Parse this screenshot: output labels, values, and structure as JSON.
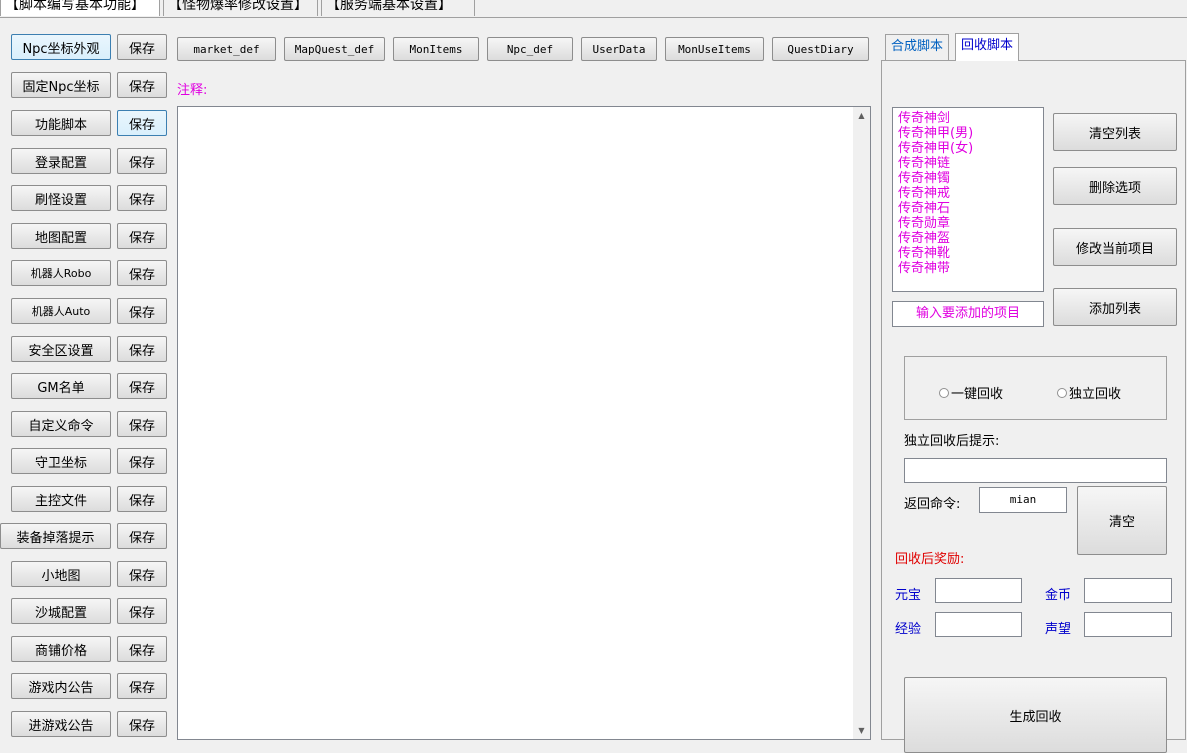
{
  "top_tabs": [
    {
      "label": "【脚本编写基本功能】",
      "active": true
    },
    {
      "label": "【怪物爆率修改设置】",
      "active": false
    },
    {
      "label": "【服务端基本设置】",
      "active": false
    }
  ],
  "left_panel": {
    "items": [
      {
        "label": "Npc坐标外观",
        "save": "保存"
      },
      {
        "label": "固定Npc坐标",
        "save": "保存"
      },
      {
        "label": "功能脚本",
        "save": "保存"
      },
      {
        "label": "登录配置",
        "save": "保存"
      },
      {
        "label": "刷怪设置",
        "save": "保存"
      },
      {
        "label": "地图配置",
        "save": "保存"
      },
      {
        "label": "机器人Robo",
        "save": "保存"
      },
      {
        "label": "机器人Auto",
        "save": "保存"
      },
      {
        "label": "安全区设置",
        "save": "保存"
      },
      {
        "label": "GM名单",
        "save": "保存"
      },
      {
        "label": "自定义命令",
        "save": "保存"
      },
      {
        "label": "守卫坐标",
        "save": "保存"
      },
      {
        "label": "主控文件",
        "save": "保存"
      },
      {
        "label": "装备掉落提示",
        "save": "保存"
      },
      {
        "label": "小地图",
        "save": "保存"
      },
      {
        "label": "沙城配置",
        "save": "保存"
      },
      {
        "label": "商铺价格",
        "save": "保存"
      },
      {
        "label": "游戏内公告",
        "save": "保存"
      },
      {
        "label": "进游戏公告",
        "save": "保存"
      }
    ]
  },
  "file_buttons": [
    "market_def",
    "MapQuest_def",
    "MonItems",
    "Npc_def",
    "UserData",
    "MonUseItems",
    "QuestDiary"
  ],
  "editor": {
    "note_label": "注释:",
    "content": "",
    "scroll_up": "▲",
    "scroll_down": "▼"
  },
  "right_panel": {
    "tabs": [
      {
        "label": "合成脚本",
        "active": false
      },
      {
        "label": "回收脚本",
        "active": true
      }
    ],
    "list_items": [
      "传奇神剑",
      "传奇神甲(男)",
      "传奇神甲(女)",
      "传奇神链",
      "传奇神镯",
      "传奇神戒",
      "传奇神石",
      "传奇勋章",
      "传奇神盔",
      "传奇神靴",
      "传奇神带"
    ],
    "buttons": {
      "clear_list": "清空列表",
      "delete_item": "删除选项",
      "modify_item": "修改当前项目",
      "add_list": "添加列表",
      "clear": "清空",
      "generate": "生成回收"
    },
    "add_input_placeholder": "输入要添加的项目",
    "radio": {
      "one_click": "一键回收",
      "independent": "独立回收"
    },
    "after_tip_label": "独立回收后提示:",
    "after_tip_value": "",
    "return_cmd_label": "返回命令:",
    "return_cmd_value": "mian",
    "reward_label": "回收后奖励:",
    "reward_fields": {
      "yuanbao": "元宝",
      "gold": "金币",
      "exp": "经验",
      "prestige": "声望"
    },
    "colors": {
      "magenta": "#e000e0",
      "blue": "#0000cc",
      "red": "#e00000"
    }
  }
}
